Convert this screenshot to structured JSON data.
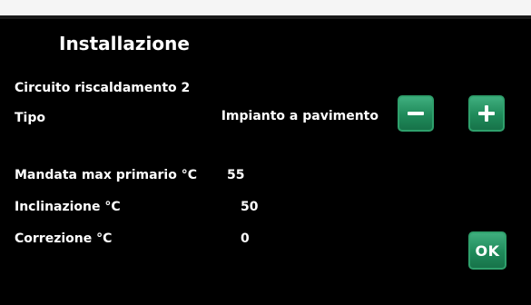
{
  "header": {
    "title": "Installazione"
  },
  "section": {
    "name": "Circuito riscaldamento 2"
  },
  "fields": [
    {
      "label": "Tipo",
      "value": "Impianto a pavimento"
    },
    {
      "label": "Mandata max primario °C",
      "value": "55"
    },
    {
      "label": "Inclinazione °C",
      "value": "50"
    },
    {
      "label": "Correzione °C",
      "value": "0"
    }
  ],
  "buttons": {
    "decrease": "minus-icon",
    "increase": "plus-icon",
    "ok_label": "OK"
  },
  "colors": {
    "background": "#000000",
    "text": "#ffffff",
    "button_green": "#1f8a5a"
  }
}
